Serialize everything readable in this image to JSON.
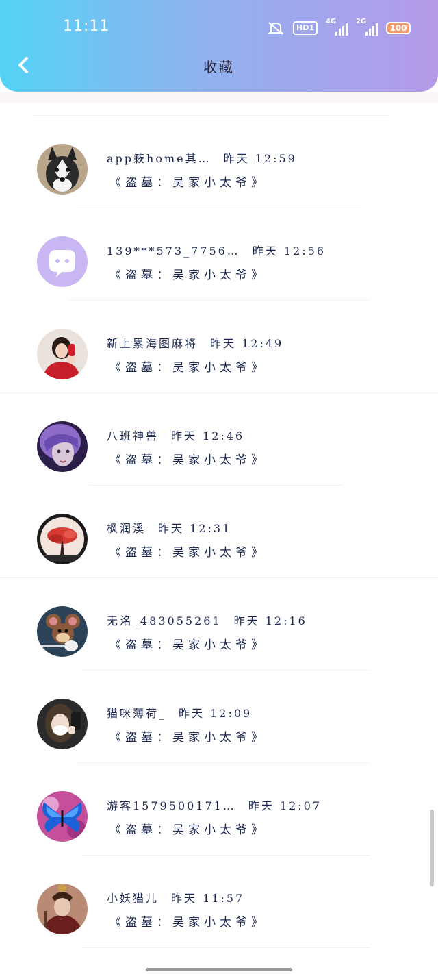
{
  "status_bar": {
    "time": "11:11",
    "hd": "HD1",
    "net1": "4G",
    "net2": "2G",
    "battery": "100",
    "icons": [
      "mute-icon",
      "hd-icon",
      "signal-4g-icon",
      "signal-2g-icon",
      "battery-icon"
    ]
  },
  "header": {
    "title": "收藏",
    "back_icon": "chevron-left-icon"
  },
  "items": [
    {
      "name": "app簌home其…",
      "time": "昨天 12:59",
      "subtitle": "《盗墓：吴家小太爷》",
      "avatar": "husky"
    },
    {
      "name": "139***573_7756…",
      "time": "昨天 12:56",
      "subtitle": "《盗墓：吴家小太爷》",
      "avatar": "default"
    },
    {
      "name": "新上累海图麻将",
      "time": "昨天 12:49",
      "subtitle": "《盗墓：吴家小太爷》",
      "avatar": "girl-red"
    },
    {
      "name": "八班神兽",
      "time": "昨天 12:46",
      "subtitle": "《盗墓：吴家小太爷》",
      "avatar": "purple-hair"
    },
    {
      "name": "枫润溪",
      "time": "昨天 12:31",
      "subtitle": "《盗墓：吴家小太爷》",
      "avatar": "red-tree"
    },
    {
      "name": "无洺_483055261",
      "time": "昨天 12:16",
      "subtitle": "《盗墓：吴家小太爷》",
      "avatar": "cartoon-mouse"
    },
    {
      "name": "猫咪薄荷_",
      "time": "昨天 12:09",
      "subtitle": "《盗墓：吴家小太爷》",
      "avatar": "masked-girl"
    },
    {
      "name": "游客1579500171…",
      "time": "昨天 12:07",
      "subtitle": "《盗墓：吴家小太爷》",
      "avatar": "blue-butterfly"
    },
    {
      "name": "小妖猫儿",
      "time": "昨天 11:57",
      "subtitle": "《盗墓：吴家小太爷》",
      "avatar": "costume-figure"
    }
  ]
}
